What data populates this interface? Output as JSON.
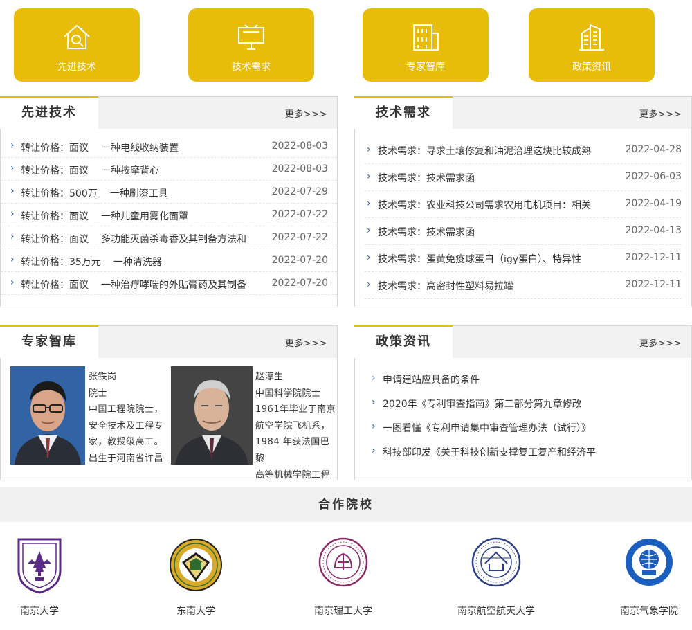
{
  "tiles": [
    {
      "label": "先进技术",
      "icon": "house-search-icon"
    },
    {
      "label": "技术需求",
      "icon": "billboard-icon"
    },
    {
      "label": "专家智库",
      "icon": "building-icon"
    },
    {
      "label": "政策资讯",
      "icon": "skyscraper-icon"
    }
  ],
  "more_label": "更多>>>",
  "adv_tech": {
    "title": "先进技术",
    "rows": [
      {
        "price": "转让价格：面议",
        "name": "一种电线收纳装置",
        "date": "2022-08-03"
      },
      {
        "price": "转让价格：面议",
        "name": "一种按摩背心",
        "date": "2022-08-03"
      },
      {
        "price": "转让价格：500万",
        "name": "一种刷漆工具",
        "date": "2022-07-29"
      },
      {
        "price": "转让价格：面议",
        "name": "一种儿童用雾化面罩",
        "date": "2022-07-22"
      },
      {
        "price": "转让价格：面议",
        "name": "多功能灭菌杀毒香及其制备方法和",
        "date": "2022-07-22"
      },
      {
        "price": "转让价格：35万元",
        "name": "一种清洗器",
        "date": "2022-07-20"
      },
      {
        "price": "转让价格：面议",
        "name": "一种治疗哮喘的外贴膏药及其制备",
        "date": "2022-07-20"
      }
    ]
  },
  "tech_demand": {
    "title": "技术需求",
    "rows": [
      {
        "text": "技术需求：寻求土壤修复和油泥治理这块比较成熟",
        "date": "2022-04-28"
      },
      {
        "text": "技术需求：技术需求函",
        "date": "2022-06-03"
      },
      {
        "text": "技术需求：农业科技公司需求农用电机项目：相关",
        "date": "2022-04-19"
      },
      {
        "text": "技术需求：技术需求函",
        "date": "2022-04-13"
      },
      {
        "text": "技术需求：蛋黄免疫球蛋白（igy蛋白）、特异性",
        "date": "2022-12-11"
      },
      {
        "text": "技术需求：高密封性塑料易拉罐",
        "date": "2022-12-11"
      }
    ]
  },
  "experts": {
    "title": "专家智库",
    "items": [
      {
        "lines": [
          "张铁岗",
          "院士",
          "中国工程院院士，",
          "安全技术及工程专",
          "家，教授级高工。",
          "出生于河南省许昌"
        ]
      },
      {
        "lines": [
          "赵淳生",
          "中国科学院院士",
          "1961年毕业于南京",
          "航空学院飞机系，",
          "1984 年获法国巴黎",
          "高等机械学院工程"
        ]
      }
    ]
  },
  "policy": {
    "title": "政策资讯",
    "rows": [
      "申请建站应具备的条件",
      "2020年《专利审查指南》第二部分第九章修改",
      "一图看懂《专利申请集中审查管理办法（试行）》",
      "科技部印发《关于科技创新支撑复工复产和经济平"
    ]
  },
  "partners": {
    "title": "合作院校",
    "schools": [
      {
        "name": "南京大学",
        "color": "#5b2a86"
      },
      {
        "name": "东南大学",
        "color": "#2f6b2f"
      },
      {
        "name": "南京理工大学",
        "color": "#8a2a6a"
      },
      {
        "name": "南京航空航天大学",
        "color": "#2a3e86"
      },
      {
        "name": "南京气象学院",
        "color": "#1a5fbf"
      }
    ]
  }
}
